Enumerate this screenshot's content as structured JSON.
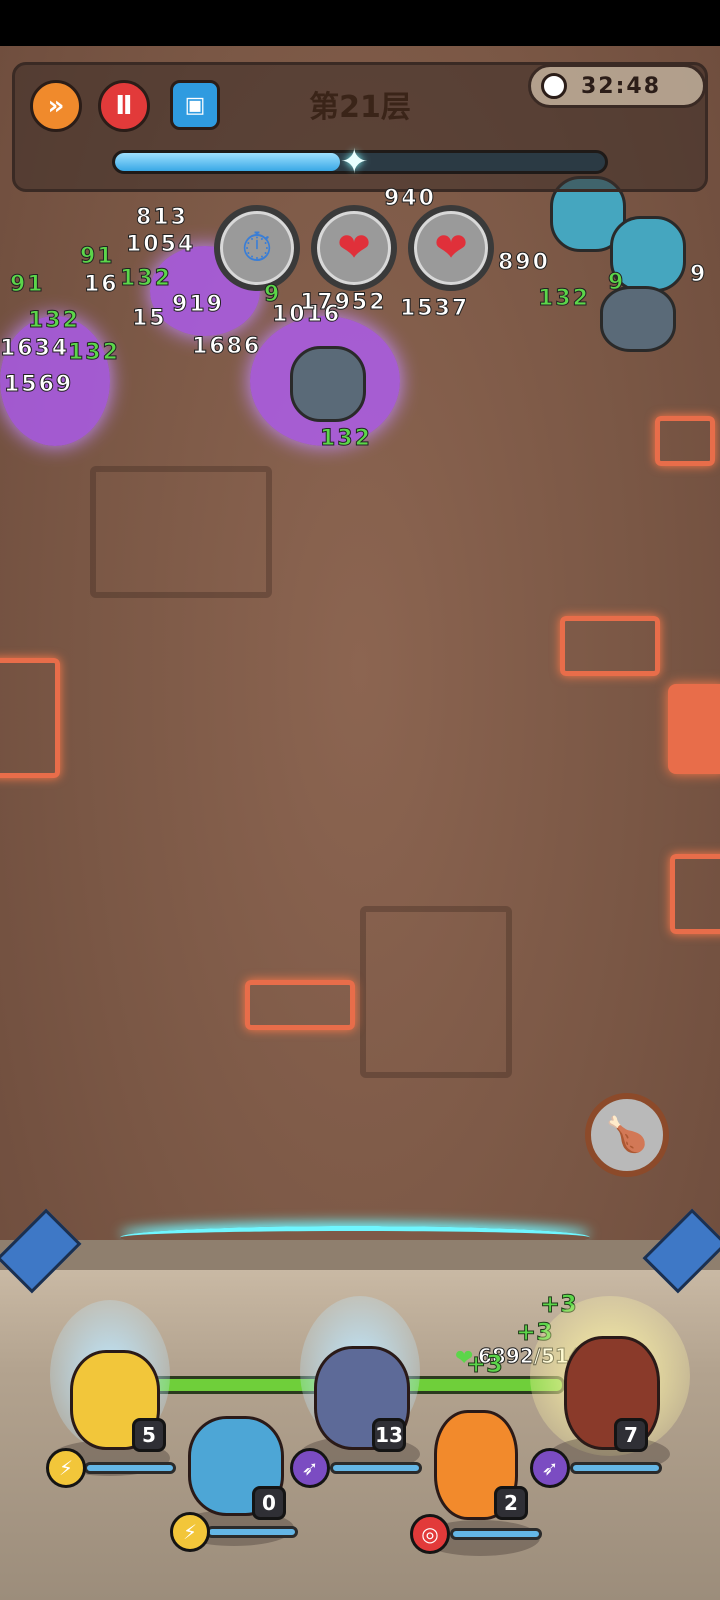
{
  "hud": {
    "floor_title": "第21层",
    "timer": "32:48",
    "progress_fraction": 0.46,
    "speed_icon": "fast-forward-icon",
    "pause_icon": "pause-icon",
    "skill_icon": "card-icon"
  },
  "buffs": [
    {
      "name": "slow-timer-buff-icon",
      "glyph": "⏱"
    },
    {
      "name": "heal-up-buff-icon",
      "glyph": "❤"
    },
    {
      "name": "heal-up-buff-icon-2",
      "glyph": "❤"
    }
  ],
  "damage_numbers": {
    "white": [
      "813",
      "1054",
      "16",
      "919",
      "15",
      "1016",
      "1686",
      "1634",
      "1569",
      "940",
      "1537",
      "890",
      "17952",
      "9"
    ],
    "green": [
      "91",
      "91",
      "132",
      "132",
      "132",
      "9",
      "132",
      "9",
      "132"
    ]
  },
  "food_button_icon": "meal-plate-icon",
  "team": {
    "hp_text": "6892/5140)",
    "heal_popups": [
      "+3",
      "+3",
      "+3"
    ]
  },
  "heroes": [
    {
      "name": "hero-horned-warrior",
      "level": "5",
      "skill": "lightning-icon",
      "skill_glyph": "⚡",
      "skill_color": "#f2c63a",
      "mana": 0.0
    },
    {
      "name": "hero-blue-troll",
      "level": "0",
      "skill": "lightning-icon",
      "skill_glyph": "⚡",
      "skill_color": "#f2c63a",
      "mana": 0.0
    },
    {
      "name": "hero-dark-archer",
      "level": "13",
      "skill": "arrow-icon",
      "skill_glyph": "➶",
      "skill_color": "#7b4cc2",
      "mana": 0.0
    },
    {
      "name": "hero-fire-spirit",
      "level": "2",
      "skill": "target-icon",
      "skill_glyph": "◎",
      "skill_color": "#e23a3a",
      "mana": 0.0
    },
    {
      "name": "hero-hooded-mage",
      "level": "7",
      "skill": "arrow-icon",
      "skill_glyph": "➶",
      "skill_color": "#7b4cc2",
      "mana": 0.0
    }
  ]
}
